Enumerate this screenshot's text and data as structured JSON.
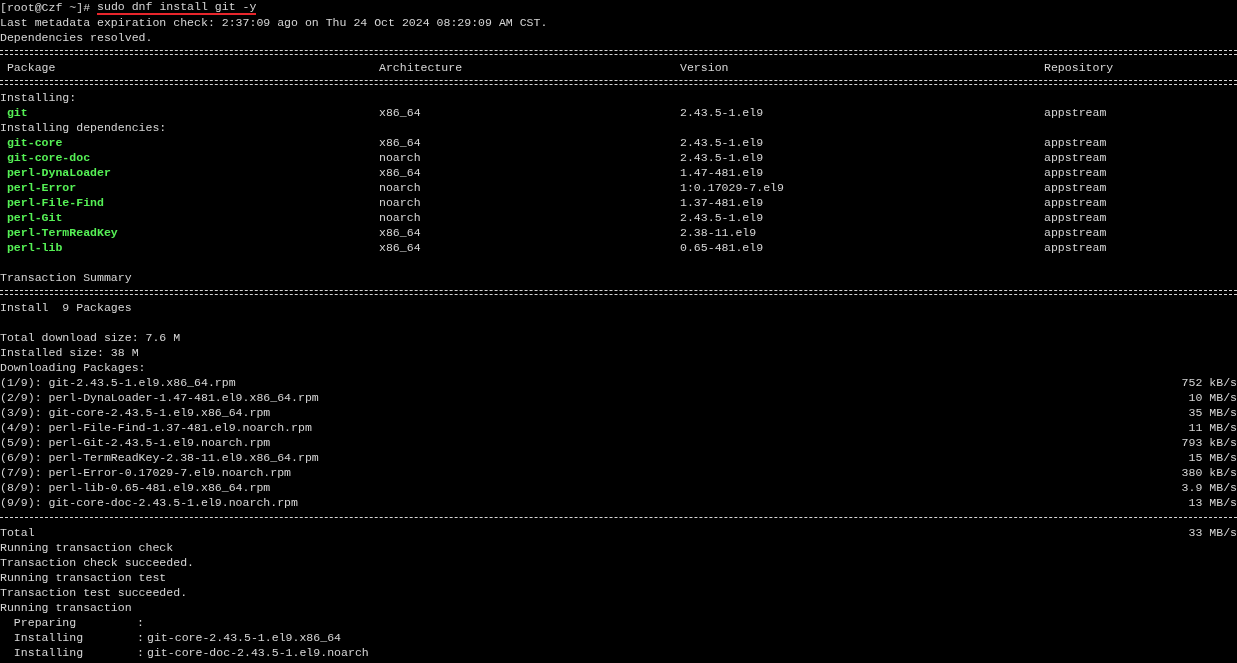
{
  "terminal": {
    "lines": [
      {
        "kind": "prompt",
        "prompt": "[root@Czf ~]#",
        "command": "sudo dnf install git -y",
        "underlined": true
      },
      {
        "kind": "text",
        "text": "Last metadata expiration check: 2:37:09 ago on Thu 24 Oct 2024 08:29:09 AM CST."
      },
      {
        "kind": "text",
        "text": "Dependencies resolved."
      },
      {
        "kind": "double-rule"
      },
      {
        "kind": "header",
        "columns": [
          "Package",
          "Architecture",
          "Version",
          "Repository"
        ]
      },
      {
        "kind": "double-rule"
      },
      {
        "kind": "section",
        "text": "Installing:"
      },
      {
        "kind": "package",
        "name": "git",
        "arch": "x86_64",
        "version": "2.43.5-1.el9",
        "repo": "appstream"
      },
      {
        "kind": "section",
        "text": "Installing dependencies:"
      },
      {
        "kind": "package",
        "name": "git-core",
        "arch": "x86_64",
        "version": "2.43.5-1.el9",
        "repo": "appstream"
      },
      {
        "kind": "package",
        "name": "git-core-doc",
        "arch": "noarch",
        "version": "2.43.5-1.el9",
        "repo": "appstream"
      },
      {
        "kind": "package",
        "name": "perl-DynaLoader",
        "arch": "x86_64",
        "version": "1.47-481.el9",
        "repo": "appstream"
      },
      {
        "kind": "package",
        "name": "perl-Error",
        "arch": "noarch",
        "version": "1:0.17029-7.el9",
        "repo": "appstream"
      },
      {
        "kind": "package",
        "name": "perl-File-Find",
        "arch": "noarch",
        "version": "1.37-481.el9",
        "repo": "appstream"
      },
      {
        "kind": "package",
        "name": "perl-Git",
        "arch": "noarch",
        "version": "2.43.5-1.el9",
        "repo": "appstream"
      },
      {
        "kind": "package",
        "name": "perl-TermReadKey",
        "arch": "x86_64",
        "version": "2.38-11.el9",
        "repo": "appstream"
      },
      {
        "kind": "package",
        "name": "perl-lib",
        "arch": "x86_64",
        "version": "0.65-481.el9",
        "repo": "appstream"
      },
      {
        "kind": "blank"
      },
      {
        "kind": "section",
        "text": "Transaction Summary"
      },
      {
        "kind": "double-rule"
      },
      {
        "kind": "text",
        "text": "Install  9 Packages"
      },
      {
        "kind": "blank"
      },
      {
        "kind": "text",
        "text": "Total download size: 7.6 M"
      },
      {
        "kind": "text",
        "text": "Installed size: 38 M"
      },
      {
        "kind": "section",
        "text": "Downloading Packages:"
      },
      {
        "kind": "download",
        "file": "(1/9): git-2.43.5-1.el9.x86_64.rpm",
        "speed": "752 kB/s"
      },
      {
        "kind": "download",
        "file": "(2/9): perl-DynaLoader-1.47-481.el9.x86_64.rpm",
        "speed": "10 MB/s"
      },
      {
        "kind": "download",
        "file": "(3/9): git-core-2.43.5-1.el9.x86_64.rpm",
        "speed": "35 MB/s"
      },
      {
        "kind": "download",
        "file": "(4/9): perl-File-Find-1.37-481.el9.noarch.rpm",
        "speed": "11 MB/s"
      },
      {
        "kind": "download",
        "file": "(5/9): perl-Git-2.43.5-1.el9.noarch.rpm",
        "speed": "793 kB/s"
      },
      {
        "kind": "download",
        "file": "(6/9): perl-TermReadKey-2.38-11.el9.x86_64.rpm",
        "speed": "15 MB/s"
      },
      {
        "kind": "download",
        "file": "(7/9): perl-Error-0.17029-7.el9.noarch.rpm",
        "speed": "380 kB/s"
      },
      {
        "kind": "download",
        "file": "(8/9): perl-lib-0.65-481.el9.x86_64.rpm",
        "speed": "3.9 MB/s"
      },
      {
        "kind": "download",
        "file": "(9/9): git-core-doc-2.43.5-1.el9.noarch.rpm",
        "speed": "13 MB/s"
      },
      {
        "kind": "dashed-rule"
      },
      {
        "kind": "total",
        "file": "Total",
        "speed": "33 MB/s"
      },
      {
        "kind": "text",
        "text": "Running transaction check"
      },
      {
        "kind": "text",
        "text": "Transaction check succeeded."
      },
      {
        "kind": "text",
        "text": "Running transaction test"
      },
      {
        "kind": "text",
        "text": "Transaction test succeeded."
      },
      {
        "kind": "text",
        "text": "Running transaction"
      },
      {
        "kind": "step",
        "action": "Preparing",
        "separator": ":"
      },
      {
        "kind": "step",
        "action": "Installing",
        "separator": ":",
        "detail": "git-core-2.43.5-1.el9.x86_64"
      },
      {
        "kind": "step",
        "action": "Installing",
        "separator": ":",
        "detail": "git-core-doc-2.43.5-1.el9.noarch"
      }
    ]
  }
}
